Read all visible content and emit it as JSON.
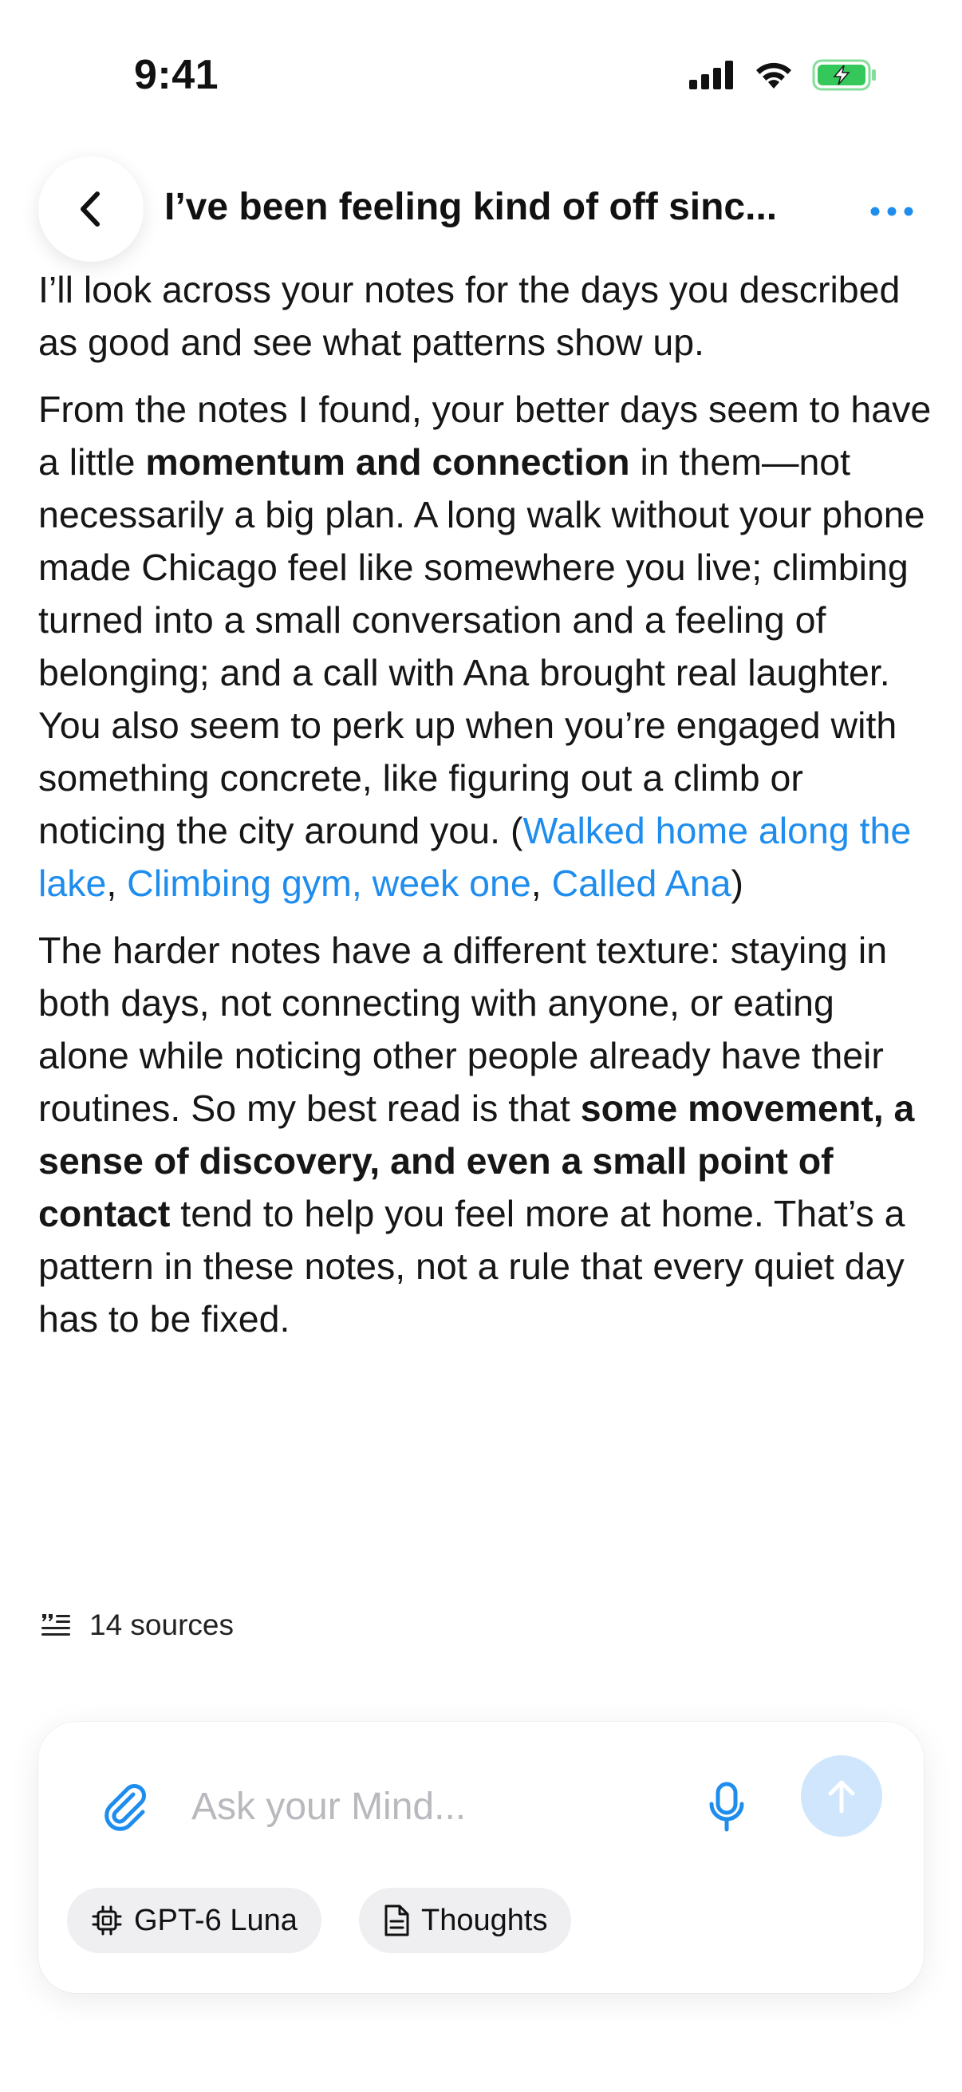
{
  "status_bar": {
    "time": "9:41",
    "icons": [
      "cellular-signal-icon",
      "wifi-icon",
      "battery-charging-icon"
    ],
    "battery_color": "#34c759"
  },
  "header": {
    "title": "I’ve been feeling kind of off sinc...",
    "back_icon": "chevron-left-icon",
    "more_icon": "ellipsis-icon",
    "accent_color": "#1f8ded"
  },
  "message": {
    "p1": "I’ll look across your notes for the days you described as good and see what patterns show up.",
    "p2": {
      "t1": "From the notes I found, your better days seem to have a little ",
      "b1": "momentum and connection",
      "t2": " in them—not necessarily a big plan. A long walk without your phone made Chicago feel like somewhere you live; climbing turned into a small conversation and a feeling of belonging; and a call with Ana brought real laughter. You also seem to perk up when you’re engaged with something concrete, like figuring out a climb or noticing the city around you. (",
      "links": [
        "Walked home along the lake",
        "Climbing gym, week one",
        "Called Ana"
      ],
      "sep": ", ",
      "close": ")"
    },
    "p3": {
      "t1": "The harder notes have a different texture: staying in both days, not connecting with anyone, or eating alone while noticing other people already have their routines. So my best read is that ",
      "b1": "some movement, a sense of discovery, and even a small point of contact",
      "t2": " tend to help you feel more at home. That’s a pattern in these notes, not a rule that every quiet day has to be fixed."
    }
  },
  "sources": {
    "icon": "quote-list-icon",
    "label": "14 sources"
  },
  "composer": {
    "placeholder": "Ask your Mind...",
    "value": "",
    "attach_icon": "paperclip-icon",
    "mic_icon": "microphone-icon",
    "send_icon": "arrow-up-icon",
    "send_color": "#cfe6fd",
    "chips": {
      "model": {
        "icon": "chip-icon",
        "label": "GPT-6 Luna"
      },
      "thoughts": {
        "icon": "document-icon",
        "label": "Thoughts"
      }
    }
  }
}
